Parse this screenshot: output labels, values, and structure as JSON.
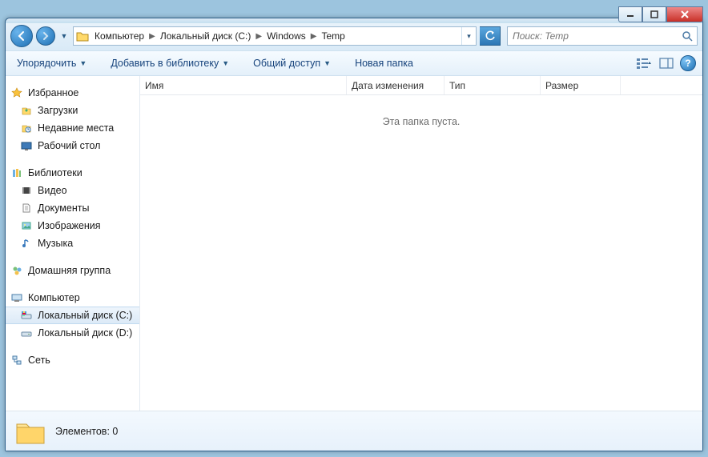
{
  "window_controls": {
    "min": "–",
    "max": "☐",
    "close": "✕"
  },
  "breadcrumbs": [
    "Компьютер",
    "Локальный диск (C:)",
    "Windows",
    "Temp"
  ],
  "search": {
    "placeholder": "Поиск: Temp"
  },
  "toolbar": {
    "organize": "Упорядочить",
    "include": "Добавить в библиотеку",
    "share": "Общий доступ",
    "newfolder": "Новая папка",
    "help": "?"
  },
  "nav": {
    "favorites": {
      "label": "Избранное",
      "items": [
        "Загрузки",
        "Недавние места",
        "Рабочий стол"
      ]
    },
    "libraries": {
      "label": "Библиотеки",
      "items": [
        "Видео",
        "Документы",
        "Изображения",
        "Музыка"
      ]
    },
    "homegroup": {
      "label": "Домашняя группа"
    },
    "computer": {
      "label": "Компьютер",
      "items": [
        "Локальный диск (C:)",
        "Локальный диск (D:)"
      ]
    },
    "network": {
      "label": "Сеть"
    }
  },
  "columns": {
    "name": "Имя",
    "date": "Дата изменения",
    "type": "Тип",
    "size": "Размер"
  },
  "empty_message": "Эта папка пуста.",
  "status": {
    "label": "Элементов: 0"
  }
}
